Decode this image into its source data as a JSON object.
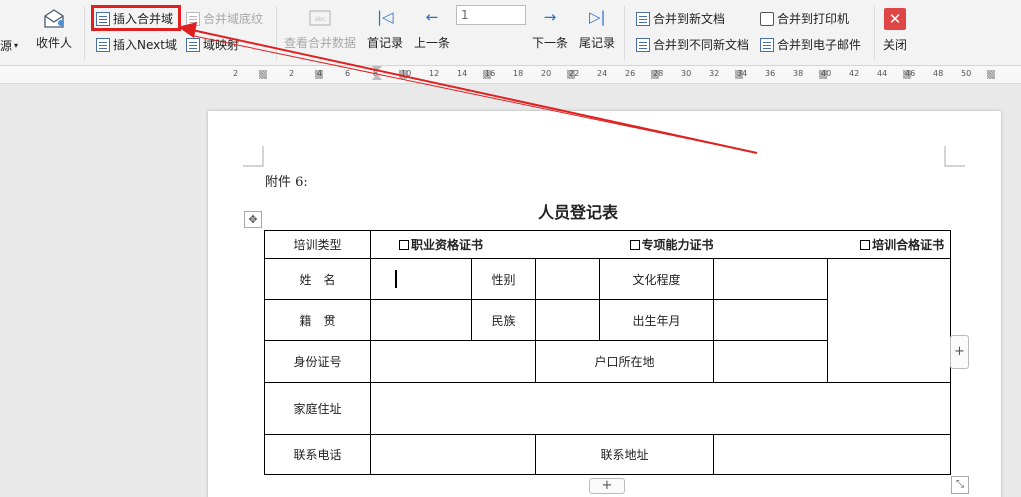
{
  "ribbon": {
    "source_label": "源",
    "recipients_label": "收件人",
    "insert_merge_field": "插入合并域",
    "merge_field_shading": "合并域底纹",
    "insert_next_field": "插入Next域",
    "field_mapping": "域映射",
    "view_merged_data": "查看合并数据",
    "first_record": "首记录",
    "prev_record": "上一条",
    "record_number": "1",
    "next_record": "下一条",
    "last_record": "尾记录",
    "merge_to_new_doc": "合并到新文档",
    "merge_to_diff_docs": "合并到不同新文档",
    "merge_to_printer": "合并到打印机",
    "merge_to_email": "合并到电子邮件",
    "close": "关闭"
  },
  "ruler": {
    "ticks": [
      "2",
      "2",
      "4",
      "6",
      "8",
      "10",
      "12",
      "14",
      "16",
      "18",
      "20",
      "22",
      "24",
      "26",
      "28",
      "30",
      "32",
      "34",
      "36",
      "38",
      "40",
      "42",
      "44",
      "46",
      "48",
      "50"
    ]
  },
  "document": {
    "heading": "附件 6:",
    "title": "人员登记表",
    "table": {
      "training_type_label": "培训类型",
      "option1": "职业资格证书",
      "option2": "专项能力证书",
      "option3": "培训合格证书",
      "name_label": "姓　名",
      "gender_label": "性别",
      "education_label": "文化程度",
      "native_place_label": "籍　贯",
      "ethnicity_label": "民族",
      "birth_label": "出生年月",
      "id_label": "身份证号",
      "hukou_label": "户口所在地",
      "address_label": "家庭住址",
      "phone_label": "联系电话",
      "contact_address_label": "联系地址"
    }
  },
  "controls": {
    "add_column": "+",
    "add_row": "+",
    "table_move": "✥",
    "resize": "⤡"
  },
  "colors": {
    "highlight": "#e02020",
    "nav_blue": "#2f6fc4",
    "close_red": "#e04545"
  }
}
